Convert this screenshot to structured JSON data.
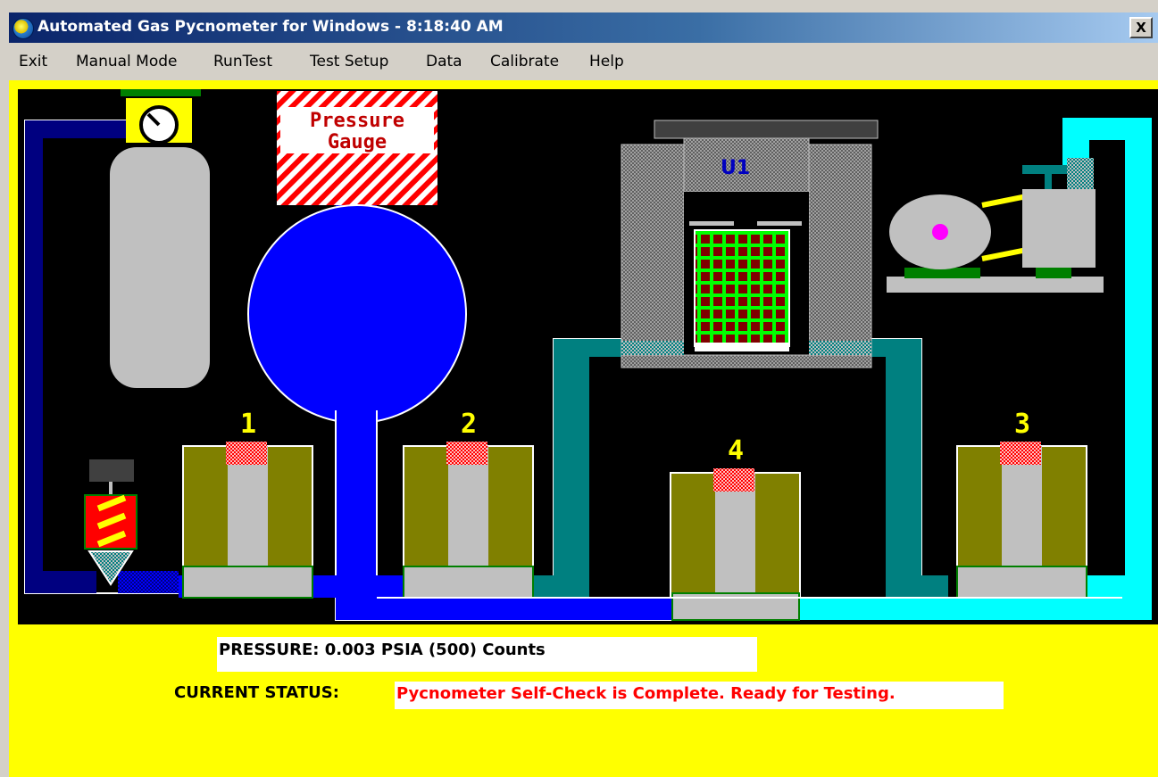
{
  "window": {
    "title": "Automated Gas Pycnometer for Windows - 8:18:40 AM",
    "close_label": "X"
  },
  "menu": {
    "items": [
      "Exit",
      "Manual Mode",
      "RunTest",
      "Test Setup",
      "Data",
      "Calibrate",
      "Help"
    ]
  },
  "diagram": {
    "gauge_label_line1": "Pressure",
    "gauge_label_line2": "Gauge",
    "cell_label": "U1",
    "valves": [
      "1",
      "2",
      "3",
      "4"
    ]
  },
  "readouts": {
    "pressure_text": "PRESSURE: 0.003 PSIA  (500) Counts",
    "status_label": "CURRENT STATUS:",
    "status_text": "Pycnometer Self-Check is Complete. Ready for Testing."
  },
  "colors": {
    "background": "#ffff00",
    "diagram_bg": "#000000",
    "gas_line_active": "#0000ff",
    "gas_line_dark": "#000080",
    "gas_line_teal": "#008080",
    "gas_line_cyan": "#00ffff",
    "valve_body": "#808000",
    "status_text": "#ff0000"
  }
}
